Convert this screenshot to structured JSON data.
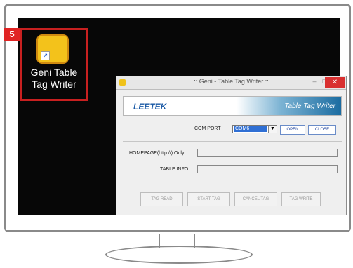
{
  "badge": {
    "number": "5"
  },
  "desktop_icon": {
    "label_line1": "Geni Table",
    "label_line2": "Tag Writer"
  },
  "window": {
    "title": ":: Geni - Table Tag Writer ::",
    "controls": {
      "minimize": "–",
      "maximize": "□",
      "close": "✕"
    }
  },
  "banner": {
    "logo": "LEETEK",
    "product": "Table Tag Writer"
  },
  "com_port": {
    "label": "COM PORT",
    "selected": "COM6",
    "open_label": "OPEN",
    "close_label": "CLOSE"
  },
  "homepage": {
    "label": "HOMEPAGE(http://) Only",
    "value": ""
  },
  "table_info": {
    "label": "TABLE INFO",
    "value": ""
  },
  "actions": {
    "tag_read": "TAG READ",
    "start_tag": "START TAG",
    "cancel_tag": "CANCEL TAG",
    "tag_write": "TAG WRITE"
  },
  "colors": {
    "badge": "#e12424",
    "highlight_box": "#c82020",
    "screen": "#070707",
    "banner_blue": "#1b6ca1",
    "select_blue": "#2f6fd4"
  }
}
